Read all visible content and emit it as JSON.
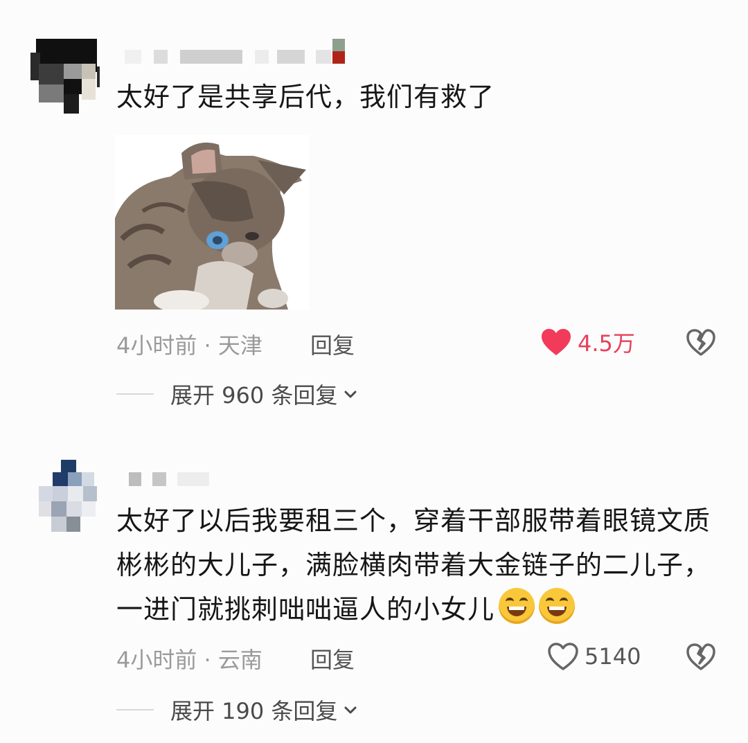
{
  "comments": [
    {
      "text": "太好了是共享后代，我们有救了",
      "time_location": "4小时前 · 天津",
      "reply_label": "回复",
      "like_count": "4.5万",
      "liked": true,
      "expand_label": "展开 960 条回复",
      "has_sticker": true,
      "sticker": "kitten-sticker"
    },
    {
      "text": "太好了以后我要租三个，穿着干部服带着眼镜文质彬彬的大儿子，满脸横肉带着大金链子的二儿子，一进门就挑刺咄咄逼人的小女儿",
      "emoji": [
        "grin-emoji",
        "grin-emoji"
      ],
      "time_location": "4小时前 · 云南",
      "reply_label": "回复",
      "like_count": "5140",
      "liked": false,
      "expand_label": "展开 190 条回复"
    }
  ],
  "colors": {
    "like_active": "#f23a5a",
    "like_count_active": "#e8405c",
    "meta_gray": "#9a9a9a",
    "icon_gray": "#666666"
  },
  "icons": {
    "like": "heart-icon",
    "dislike": "broken-heart-icon",
    "expand": "chevron-down-icon"
  }
}
